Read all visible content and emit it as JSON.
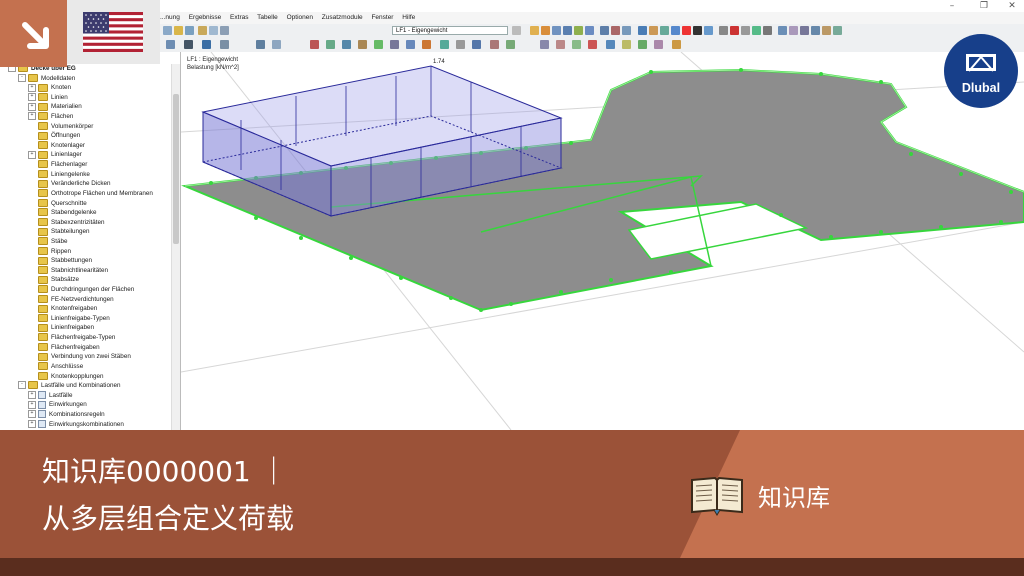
{
  "menubar": {
    "items": [
      "...nung",
      "Ergebnisse",
      "Extras",
      "Tabelle",
      "Optionen",
      "Zusatzmodule",
      "Fenster",
      "Hilfe"
    ]
  },
  "toolbar": {
    "loadcase_combo": "LF1 - Eigengewicht"
  },
  "navigator": {
    "tree": [
      {
        "label": "Decke über EG",
        "level": 0,
        "expander": "-",
        "icon": "project"
      },
      {
        "label": "Modelldaten",
        "level": 1,
        "expander": "-",
        "icon": "folder"
      },
      {
        "label": "Knoten",
        "level": 2,
        "expander": "+",
        "icon": "folder"
      },
      {
        "label": "Linien",
        "level": 2,
        "expander": "+",
        "icon": "folder"
      },
      {
        "label": "Materialien",
        "level": 2,
        "expander": "+",
        "icon": "folder"
      },
      {
        "label": "Flächen",
        "level": 2,
        "expander": "+",
        "icon": "folder"
      },
      {
        "label": "Volumenkörper",
        "level": 2,
        "expander": "",
        "icon": "folder"
      },
      {
        "label": "Öffnungen",
        "level": 2,
        "expander": "",
        "icon": "folder"
      },
      {
        "label": "Knotenlager",
        "level": 2,
        "expander": "",
        "icon": "folder"
      },
      {
        "label": "Linienlager",
        "level": 2,
        "expander": "+",
        "icon": "folder"
      },
      {
        "label": "Flächenlager",
        "level": 2,
        "expander": "",
        "icon": "folder"
      },
      {
        "label": "Liniengelenke",
        "level": 2,
        "expander": "",
        "icon": "folder"
      },
      {
        "label": "Veränderliche Dicken",
        "level": 2,
        "expander": "",
        "icon": "folder"
      },
      {
        "label": "Orthotrope Flächen und Membranen",
        "level": 2,
        "expander": "",
        "icon": "folder"
      },
      {
        "label": "Querschnitte",
        "level": 2,
        "expander": "",
        "icon": "folder"
      },
      {
        "label": "Stabendgelenke",
        "level": 2,
        "expander": "",
        "icon": "folder"
      },
      {
        "label": "Stabexzentrizitäten",
        "level": 2,
        "expander": "",
        "icon": "folder"
      },
      {
        "label": "Stabteilungen",
        "level": 2,
        "expander": "",
        "icon": "folder"
      },
      {
        "label": "Stäbe",
        "level": 2,
        "expander": "",
        "icon": "folder"
      },
      {
        "label": "Rippen",
        "level": 2,
        "expander": "",
        "icon": "folder"
      },
      {
        "label": "Stabbettungen",
        "level": 2,
        "expander": "",
        "icon": "folder"
      },
      {
        "label": "Stabnichtlinearitäten",
        "level": 2,
        "expander": "",
        "icon": "folder"
      },
      {
        "label": "Stabsätze",
        "level": 2,
        "expander": "",
        "icon": "folder"
      },
      {
        "label": "Durchdringungen der Flächen",
        "level": 2,
        "expander": "",
        "icon": "folder"
      },
      {
        "label": "FE-Netzverdichtungen",
        "level": 2,
        "expander": "",
        "icon": "folder"
      },
      {
        "label": "Knotenfreigaben",
        "level": 2,
        "expander": "",
        "icon": "folder"
      },
      {
        "label": "Linienfreigabe-Typen",
        "level": 2,
        "expander": "",
        "icon": "folder"
      },
      {
        "label": "Linienfreigaben",
        "level": 2,
        "expander": "",
        "icon": "folder"
      },
      {
        "label": "Flächenfreigabe-Typen",
        "level": 2,
        "expander": "",
        "icon": "folder"
      },
      {
        "label": "Flächenfreigaben",
        "level": 2,
        "expander": "",
        "icon": "folder"
      },
      {
        "label": "Verbindung von zwei Stäben",
        "level": 2,
        "expander": "",
        "icon": "folder"
      },
      {
        "label": "Anschlüsse",
        "level": 2,
        "expander": "",
        "icon": "folder"
      },
      {
        "label": "Knotenkopplungen",
        "level": 2,
        "expander": "",
        "icon": "folder"
      },
      {
        "label": "Lastfälle und Kombinationen",
        "level": 1,
        "expander": "-",
        "icon": "folder"
      },
      {
        "label": "Lastfälle",
        "level": 2,
        "expander": "+",
        "icon": "node"
      },
      {
        "label": "Einwirkungen",
        "level": 2,
        "expander": "+",
        "icon": "node"
      },
      {
        "label": "Kombinationsregeln",
        "level": 2,
        "expander": "+",
        "icon": "node"
      },
      {
        "label": "Einwirkungskombinationen",
        "level": 2,
        "expander": "+",
        "icon": "node"
      }
    ]
  },
  "viewport": {
    "loadcase_label": "LF1 : Eigengewicht",
    "load_label": "Belastung [kN/m^2]",
    "load_value": "1.74"
  },
  "brand": {
    "logo_text": "Dlubal",
    "accent": "#c4714f",
    "banner_color": "#9b5238",
    "logo_color": "#173f8a"
  },
  "banner": {
    "title_line1": "知识库0000001 ｜",
    "title_line2": "从多层组合定义荷载",
    "knowledge_base_label": "知识库"
  }
}
